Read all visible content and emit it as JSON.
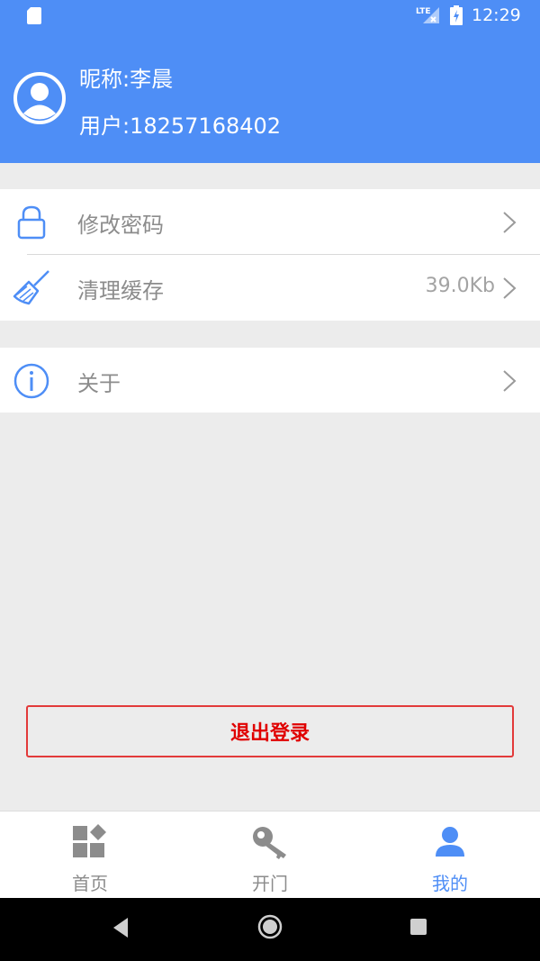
{
  "status_bar": {
    "time": "12:29",
    "network": "LTE"
  },
  "profile": {
    "nickname": "昵称:李晨",
    "user": "用户:18257168402"
  },
  "menu": {
    "change_password": "修改密码",
    "clear_cache": "清理缓存",
    "cache_size": "39.0Kb",
    "about": "关于"
  },
  "logout_label": "退出登录",
  "tabs": {
    "home": "首页",
    "open_door": "开门",
    "mine": "我的"
  },
  "colors": {
    "primary": "#4e8ef6",
    "danger": "#e00000",
    "inactive": "#8c8c8c"
  }
}
